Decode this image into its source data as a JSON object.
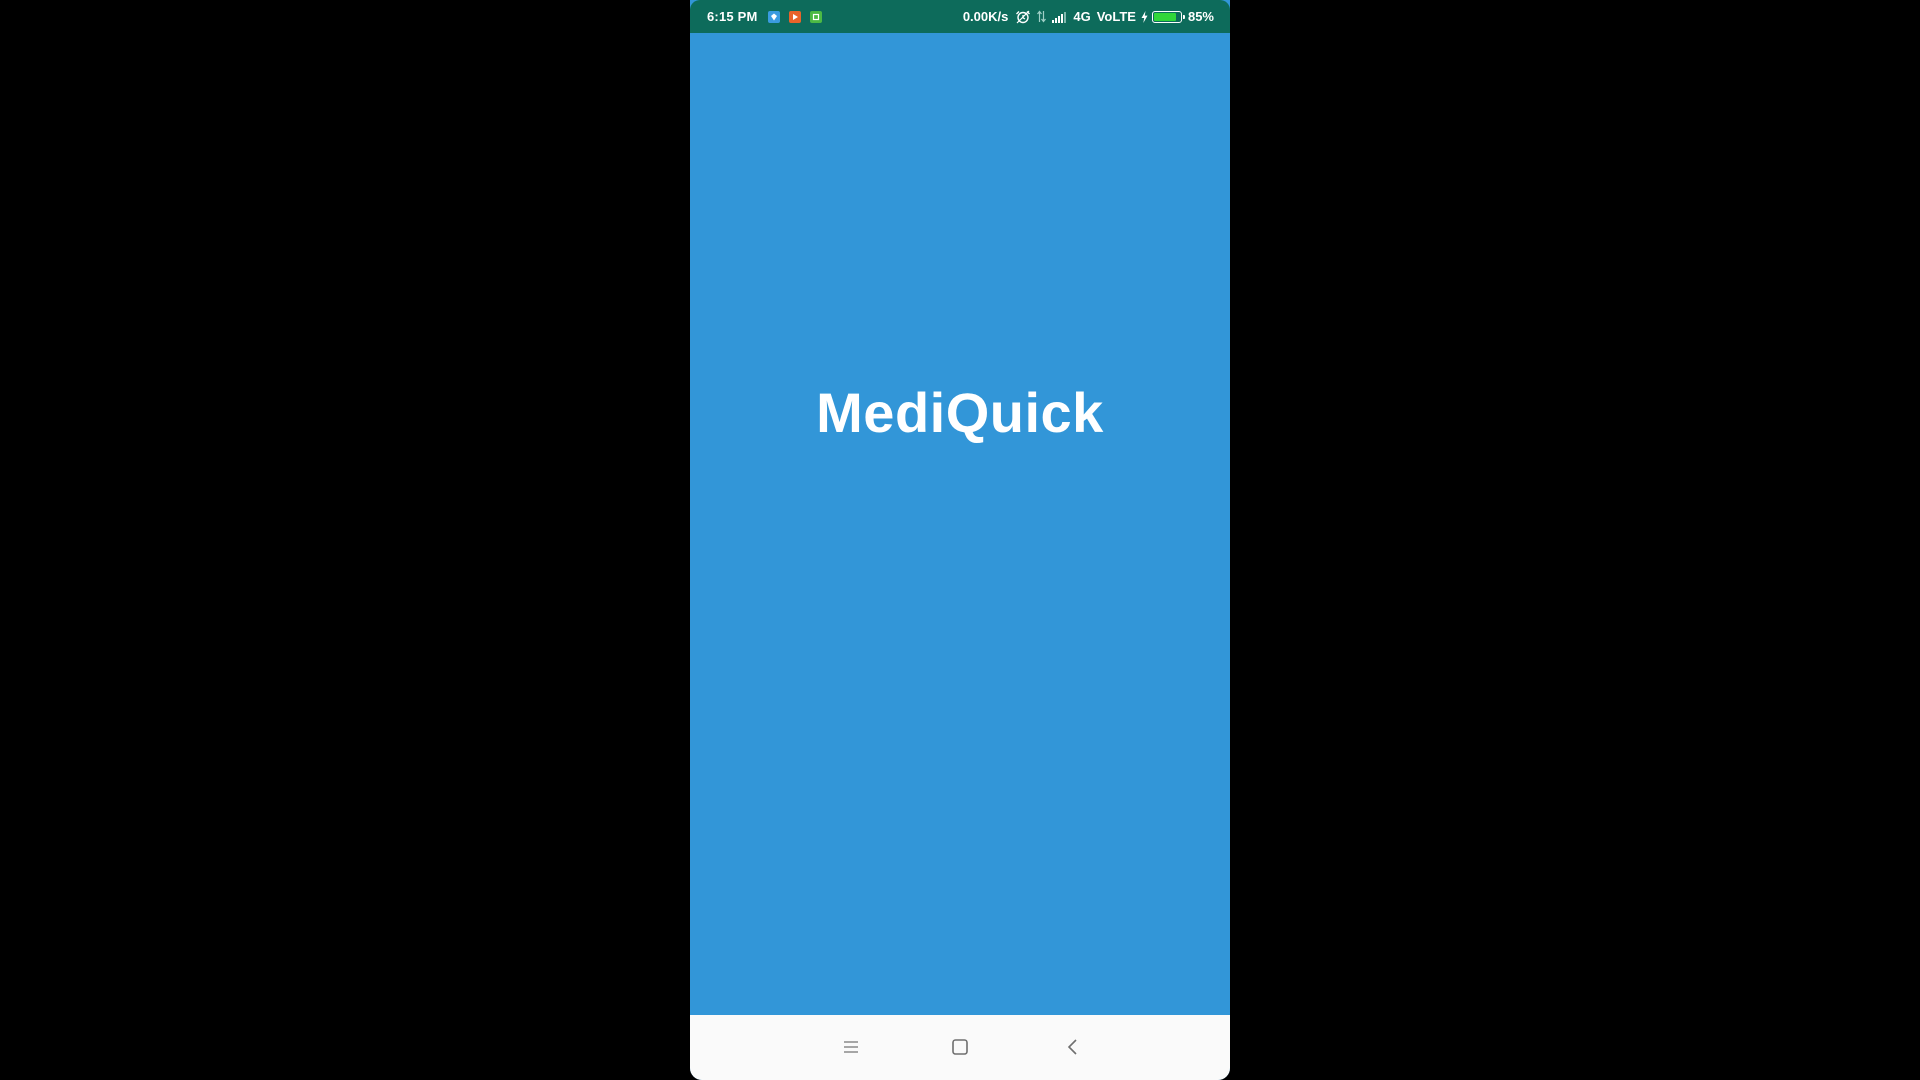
{
  "status_bar": {
    "time": "6:15 PM",
    "notification_icons": [
      "app-notification-blue-icon",
      "app-notification-orange-icon",
      "app-notification-green-icon"
    ],
    "network_speed": "0.00K/s",
    "network_type": "4G",
    "volte": "VoLTE",
    "battery_percent": "85%",
    "battery_level": 0.85,
    "background_color": "#0d6b5b",
    "battery_color": "#31d63a"
  },
  "app": {
    "title": "MediQuick",
    "background_color": "#3296d8"
  },
  "nav_bar": {
    "buttons": [
      "menu-icon",
      "home-icon",
      "back-icon"
    ]
  }
}
